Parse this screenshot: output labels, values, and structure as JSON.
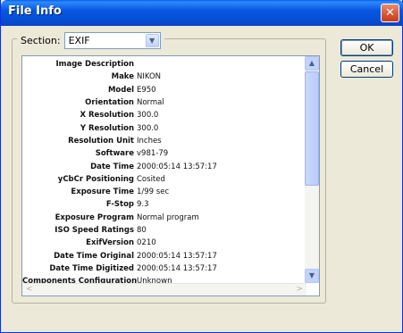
{
  "window": {
    "title": "File Info",
    "close_label": "✕"
  },
  "section": {
    "label": "Section:",
    "value": "EXIF"
  },
  "buttons": {
    "ok": "OK",
    "cancel": "Cancel"
  },
  "fields": [
    {
      "key": "Image Description",
      "value": ""
    },
    {
      "key": "Make",
      "value": "NIKON"
    },
    {
      "key": "Model",
      "value": "E950"
    },
    {
      "key": "Orientation",
      "value": "Normal"
    },
    {
      "key": "X Resolution",
      "value": "300.0"
    },
    {
      "key": "Y Resolution",
      "value": "300.0"
    },
    {
      "key": "Resolution Unit",
      "value": "Inches"
    },
    {
      "key": "Software",
      "value": "v981-79"
    },
    {
      "key": "Date Time",
      "value": "2000:05:14 13:57:17"
    },
    {
      "key": "yCbCr Positioning",
      "value": "Cosited"
    },
    {
      "key": "Exposure Time",
      "value": "1/99 sec"
    },
    {
      "key": "F-Stop",
      "value": "9.3"
    },
    {
      "key": "Exposure Program",
      "value": "Normal program"
    },
    {
      "key": "ISO Speed Ratings",
      "value": "80"
    },
    {
      "key": "ExifVersion",
      "value": "0210"
    },
    {
      "key": "Date Time Original",
      "value": "2000:05:14 13:57:17"
    },
    {
      "key": "Date Time Digitized",
      "value": "2000:05:14 13:57:17"
    },
    {
      "key": "Components Configuration",
      "value": "Unknown"
    }
  ],
  "scroll": {
    "up": "▲",
    "down": "▼",
    "left": "<",
    "right": ">"
  },
  "colors": {
    "titlebar": "#0a5fe4",
    "dialog_bg": "#ece9d8",
    "close": "#d9542f"
  }
}
